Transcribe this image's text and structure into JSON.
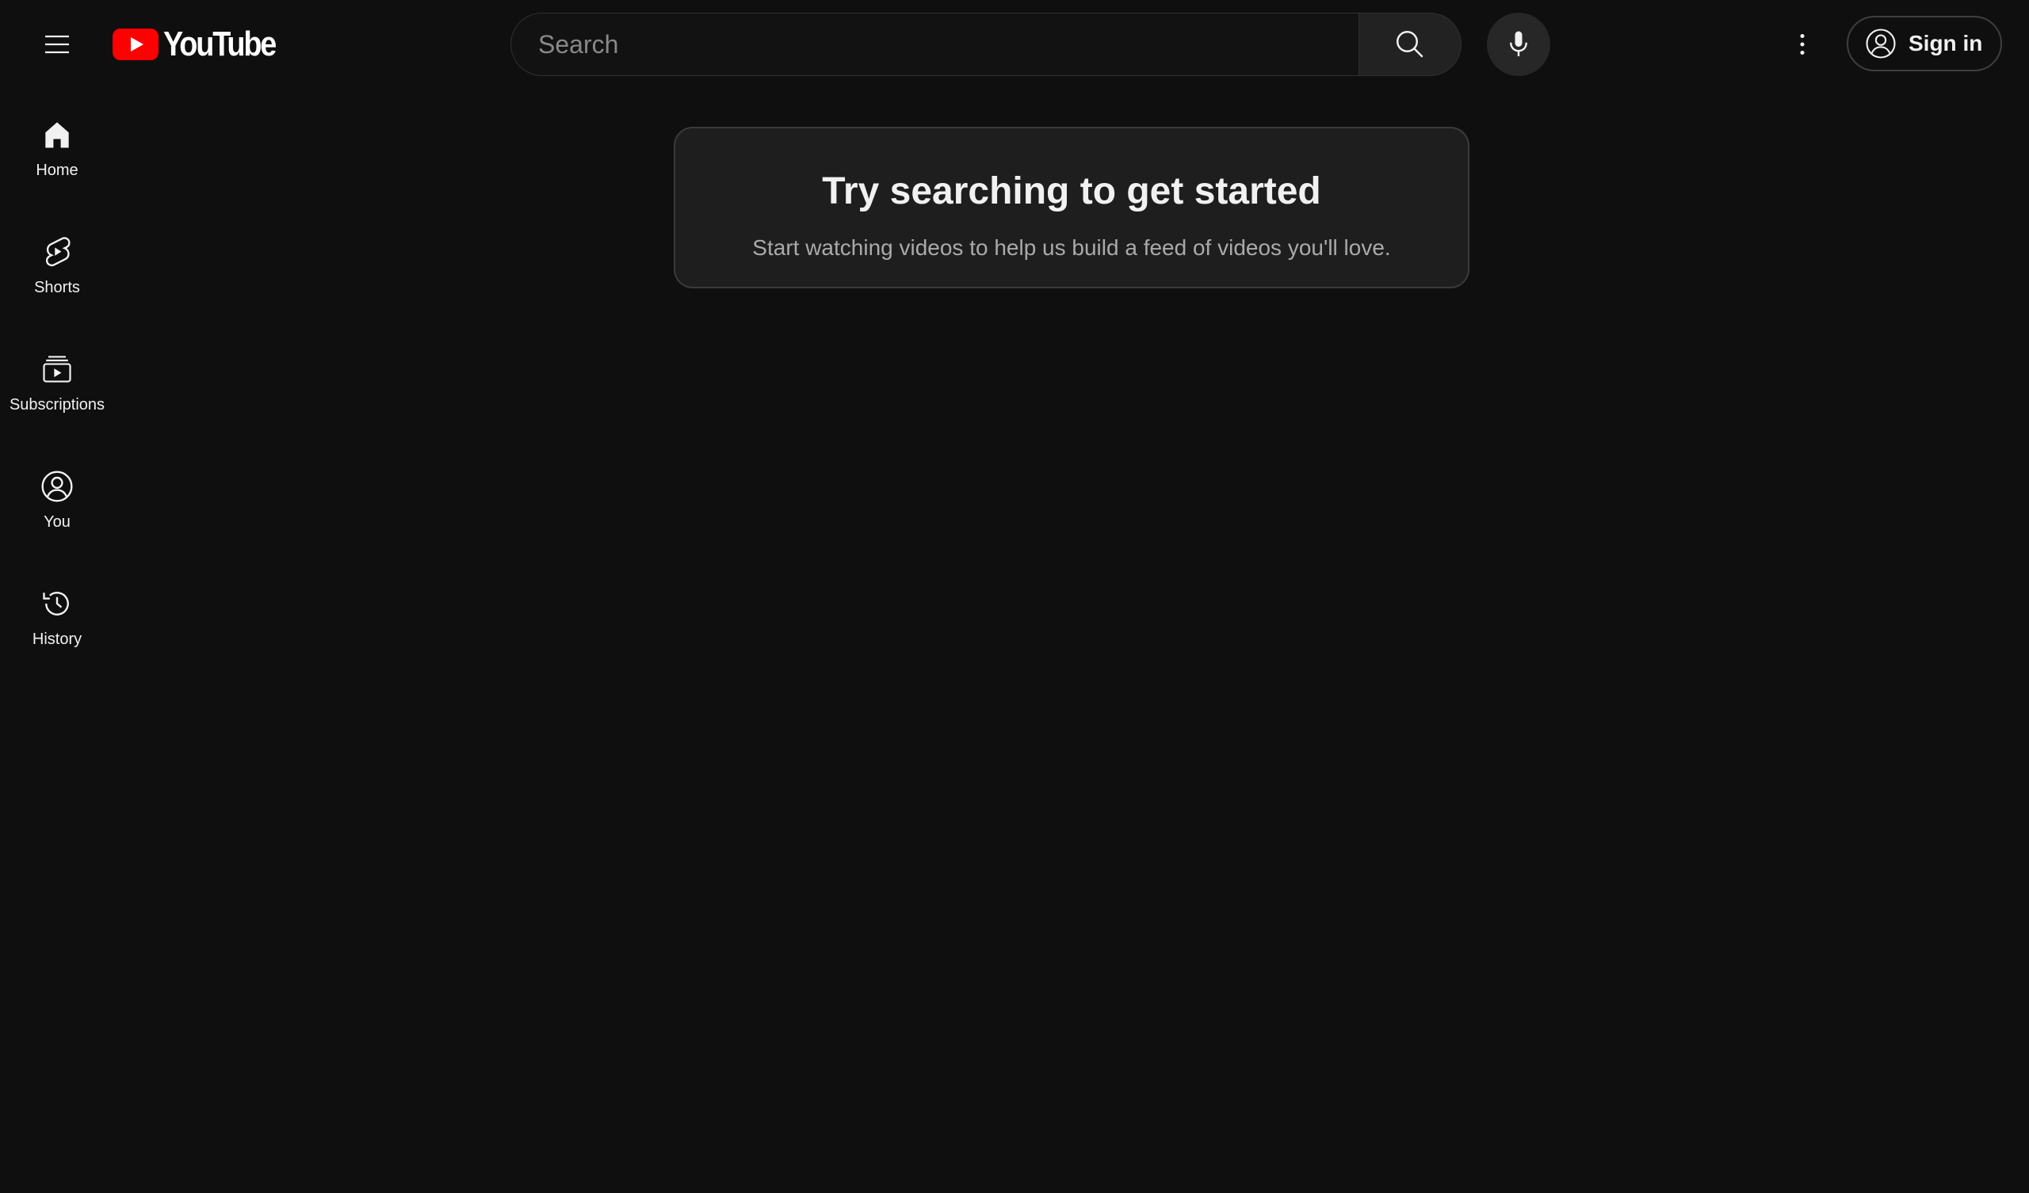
{
  "header": {
    "logo_text": "YouTube",
    "search_placeholder": "Search",
    "signin_label": "Sign in",
    "icons": {
      "menu": "hamburger-menu-icon",
      "search": "search-icon",
      "mic": "microphone-icon",
      "more": "more-vert-icon",
      "account": "account-circle-icon"
    }
  },
  "sidebar": {
    "items": [
      {
        "label": "Home",
        "icon": "home-icon"
      },
      {
        "label": "Shorts",
        "icon": "shorts-icon"
      },
      {
        "label": "Subscriptions",
        "icon": "subscriptions-icon"
      },
      {
        "label": "You",
        "icon": "you-icon"
      },
      {
        "label": "History",
        "icon": "history-icon"
      }
    ]
  },
  "main": {
    "prompt_title": "Try searching to get started",
    "prompt_subtitle": "Start watching videos to help us build a feed of videos you'll love."
  },
  "colors": {
    "background": "#0f0f0f",
    "logo_red": "#ff0000",
    "text": "#f1f1f1",
    "subtext": "#aaaaaa"
  }
}
